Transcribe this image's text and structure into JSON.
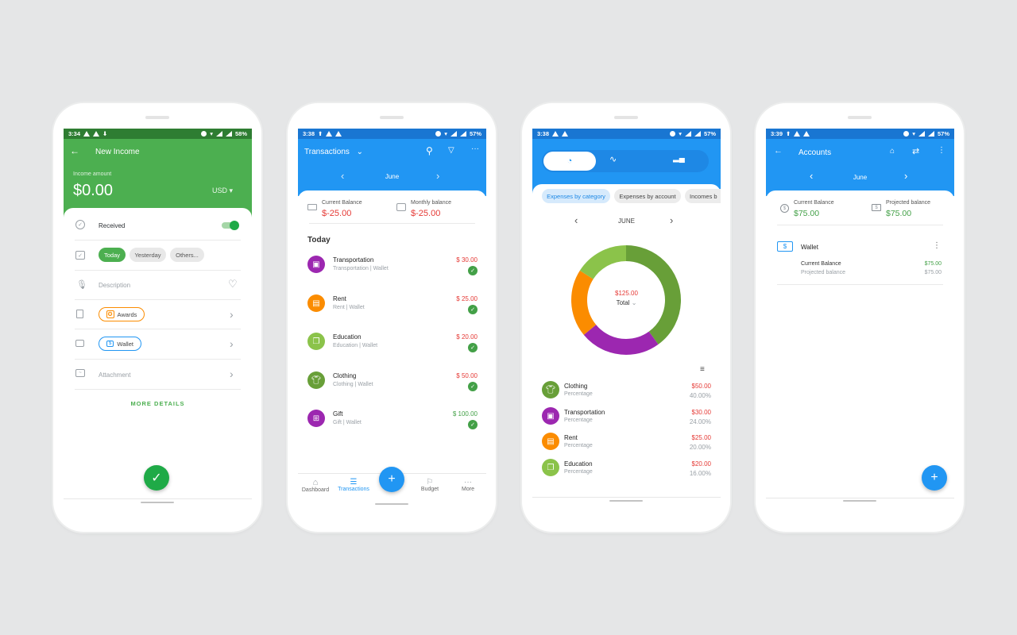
{
  "colors": {
    "green": "#4caf50",
    "green_dark": "#2e7d32",
    "blue": "#2196f3",
    "blue_dark": "#1976d2",
    "red": "#e53935"
  },
  "income": {
    "status": {
      "time": "3:34",
      "battery": "58%"
    },
    "title": "New Income",
    "amount_label": "Income amount",
    "amount": "$0.00",
    "currency": "USD",
    "received_label": "Received",
    "received": true,
    "date_chips": [
      "Today",
      "Yesterday",
      "Others..."
    ],
    "description_placeholder": "Description",
    "category": "Awards",
    "account": "Wallet",
    "attachment_label": "Attachment",
    "more_details": "MORE DETAILS"
  },
  "transactions": {
    "status": {
      "time": "3:38",
      "battery": "57%"
    },
    "title": "Transactions",
    "month": "June",
    "current_balance_label": "Current Balance",
    "current_balance": "$-25.00",
    "monthly_balance_label": "Monthly balance",
    "monthly_balance": "$-25.00",
    "section": "Today",
    "items": [
      {
        "name": "Transportation",
        "sub": "Transportation | Wallet",
        "amount": "$ 30.00",
        "color": "#9c27b0",
        "icon": "bus-icon",
        "type": "expense"
      },
      {
        "name": "Rent",
        "sub": "Rent | Wallet",
        "amount": "$ 25.00",
        "color": "#fb8c00",
        "icon": "rent-icon",
        "type": "expense"
      },
      {
        "name": "Education",
        "sub": "Education | Wallet",
        "amount": "$ 20.00",
        "color": "#8bc34a",
        "icon": "book-icon",
        "type": "expense"
      },
      {
        "name": "Clothing",
        "sub": "Clothing | Wallet",
        "amount": "$ 50.00",
        "color": "#689f38",
        "icon": "shirt-icon",
        "type": "expense"
      },
      {
        "name": "Gift",
        "sub": "Gift | Wallet",
        "amount": "$ 100.00",
        "color": "#9c27b0",
        "icon": "gift-icon",
        "type": "income"
      }
    ],
    "nav": [
      "Dashboard",
      "Transactions",
      "Budget",
      "More"
    ]
  },
  "charts": {
    "status": {
      "time": "3:38",
      "battery": "57%"
    },
    "filter_chips": [
      "Expenses by category",
      "Expenses by account",
      "Incomes b"
    ],
    "month": "JUNE",
    "total_amount": "$125.00",
    "total_label": "Total",
    "rows": [
      {
        "name": "Clothing",
        "sub": "Percentage",
        "amount": "$50.00",
        "pct": "40.00%",
        "color": "#689f38",
        "icon": "shirt-icon"
      },
      {
        "name": "Transportation",
        "sub": "Percentage",
        "amount": "$30.00",
        "pct": "24.00%",
        "color": "#9c27b0",
        "icon": "bus-icon"
      },
      {
        "name": "Rent",
        "sub": "Percentage",
        "amount": "$25.00",
        "pct": "20.00%",
        "color": "#fb8c00",
        "icon": "rent-icon"
      },
      {
        "name": "Education",
        "sub": "Percentage",
        "amount": "$20.00",
        "pct": "16.00%",
        "color": "#8bc34a",
        "icon": "book-icon"
      }
    ]
  },
  "chart_data": {
    "type": "pie",
    "categories": [
      "Clothing",
      "Transportation",
      "Rent",
      "Education"
    ],
    "values": [
      50,
      30,
      25,
      20
    ],
    "colors": [
      "#689f38",
      "#9c27b0",
      "#fb8c00",
      "#8bc34a"
    ]
  },
  "accounts": {
    "status": {
      "time": "3:39",
      "battery": "57%"
    },
    "title": "Accounts",
    "month": "June",
    "current_balance_label": "Current Balance",
    "current_balance": "$75.00",
    "projected_balance_label": "Projected balance",
    "projected_balance": "$75.00",
    "account_name": "Wallet",
    "row_current_label": "Current Balance",
    "row_current": "$75.00",
    "row_projected_label": "Projected balance",
    "row_projected": "$75.00"
  }
}
